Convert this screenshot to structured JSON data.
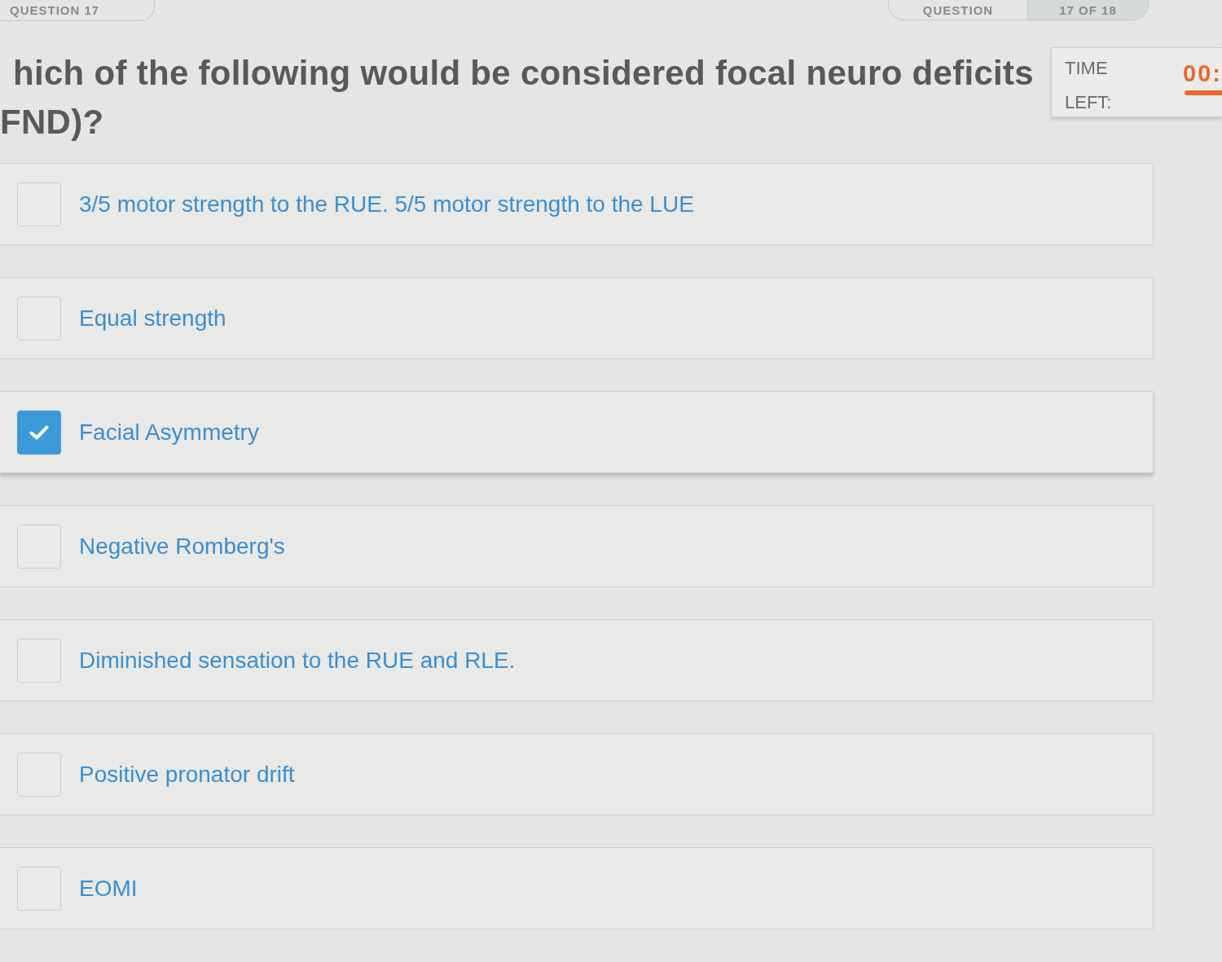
{
  "question_badge": "QUESTION 17",
  "navigator": {
    "label": "QUESTION",
    "counter": "17 OF 18"
  },
  "question": "hich of the following would be considered focal neuro deficits FND)?",
  "timer": {
    "label": "TIME LEFT:",
    "value": "00:"
  },
  "options": [
    {
      "text": "3/5 motor strength to the RUE. 5/5 motor strength to the LUE",
      "checked": false
    },
    {
      "text": "Equal strength",
      "checked": false
    },
    {
      "text": "Facial Asymmetry",
      "checked": true
    },
    {
      "text": "Negative Romberg's",
      "checked": false
    },
    {
      "text": "Diminished sensation to the RUE and RLE.",
      "checked": false
    },
    {
      "text": "Positive pronator drift",
      "checked": false
    },
    {
      "text": "EOMI",
      "checked": false
    }
  ]
}
